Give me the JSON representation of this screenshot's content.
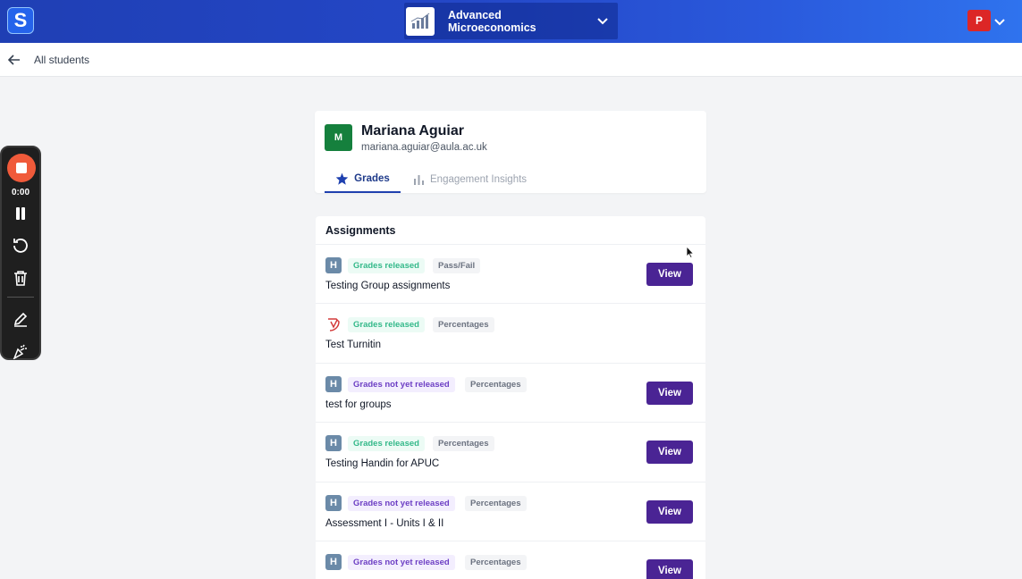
{
  "header": {
    "logo_letter": "S",
    "course": "Advanced Microeconomics",
    "user_initial": "P"
  },
  "breadcrumb": {
    "label": "All students"
  },
  "recorder": {
    "time": "0:00"
  },
  "student": {
    "initial": "M",
    "name": "Mariana Aguiar",
    "email": "mariana.aguiar@aula.ac.uk"
  },
  "tabs": {
    "grades": "Grades",
    "insights": "Engagement Insights"
  },
  "assignments": {
    "heading": "Assignments",
    "items": [
      {
        "icon": "H",
        "status": "Grades released",
        "type": "Pass/Fail",
        "title": "Testing Group assignments",
        "button": "View"
      },
      {
        "icon": "turnitin",
        "status": "Grades released",
        "type": "Percentages",
        "title": "Test Turnitin",
        "button": ""
      },
      {
        "icon": "H",
        "status": "Grades not yet released",
        "type": "Percentages",
        "title": "test for groups",
        "button": "View"
      },
      {
        "icon": "H",
        "status": "Grades released",
        "type": "Percentages",
        "title": "Testing Handin for APUC",
        "button": "View"
      },
      {
        "icon": "H",
        "status": "Grades not yet released",
        "type": "Percentages",
        "title": "Assessment I - Units I & II",
        "button": "View"
      },
      {
        "icon": "H",
        "status": "Grades not yet released",
        "type": "Percentages",
        "title": "",
        "button": "View"
      }
    ]
  },
  "colors": {
    "primary_button": "#4a2494",
    "released_text": "#34b98a",
    "not_released_text": "#6d3fc4",
    "accent_tab": "#1e40af"
  }
}
